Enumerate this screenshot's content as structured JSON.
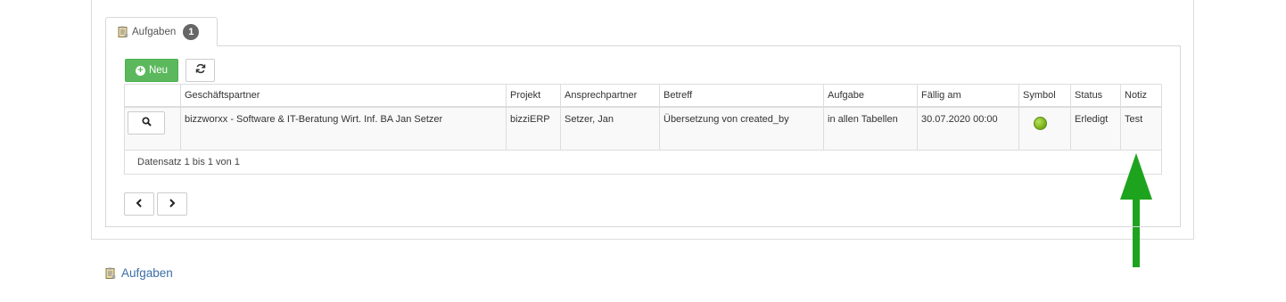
{
  "tab": {
    "label": "Aufgaben",
    "count": "1"
  },
  "toolbar": {
    "new_label": "Neu"
  },
  "table": {
    "headers": [
      "Geschäftspartner",
      "Projekt",
      "Ansprechpartner",
      "Betreff",
      "Aufgabe",
      "Fällig am",
      "Symbol",
      "Status",
      "Notiz"
    ],
    "rows": [
      {
        "partner": "bizzworxx - Software & IT-Beratung Wirt. Inf. BA Jan Setzer",
        "projekt": "bizziERP",
        "ansprechpartner": "Setzer, Jan",
        "betreff": "Übersetzung von created_by",
        "aufgabe": "in allen Tabellen",
        "faellig": "30.07.2020 00:00",
        "symbol": "green-status-dot",
        "status": "Erledigt",
        "notiz": "Test"
      }
    ],
    "footer": "Datensatz 1 bis 1 von 1"
  },
  "bottom_link": "Aufgaben",
  "colors": {
    "primary_green": "#5cb85c",
    "arrow_green": "#1ea31e",
    "link_blue": "#3a6ea5",
    "status_green": "#7cb518"
  }
}
